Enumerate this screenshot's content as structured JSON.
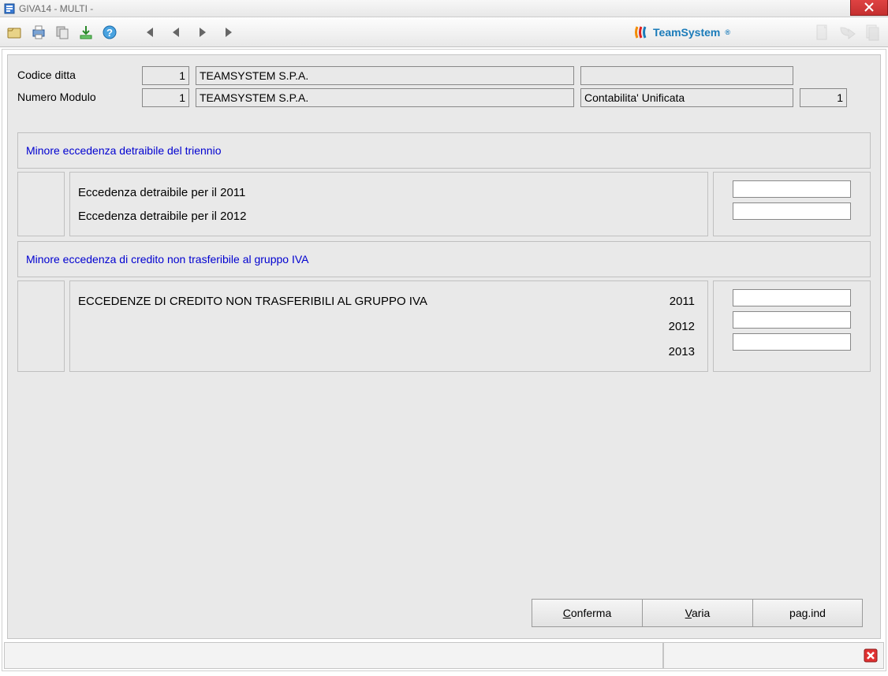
{
  "window": {
    "title": "GIVA14  - MULTI -"
  },
  "brand": "TeamSystem",
  "header": {
    "codice_ditta_label": "Codice ditta",
    "codice_ditta_value": "1",
    "numero_modulo_label": "Numero Modulo",
    "numero_modulo_value": "1",
    "company1": "TEAMSYSTEM S.P.A.",
    "company2": "TEAMSYSTEM S.P.A.",
    "account_type": "Contabilita' Unificata",
    "account_num": "1"
  },
  "section1": {
    "title": "Minore eccedenza detraibile del triennio",
    "rows": [
      "Eccedenza detraibile per il 2011",
      "Eccedenza detraibile per il 2012"
    ]
  },
  "section2": {
    "title": "Minore eccedenza di credito non trasferibile al gruppo IVA",
    "heading": "ECCEDENZE DI CREDITO NON TRASFERIBILI AL GRUPPO IVA",
    "years": [
      "2011",
      "2012",
      "2013"
    ]
  },
  "buttons": {
    "confirm": "Conferma",
    "varia": "Varia",
    "pagind": "pag.ind"
  }
}
